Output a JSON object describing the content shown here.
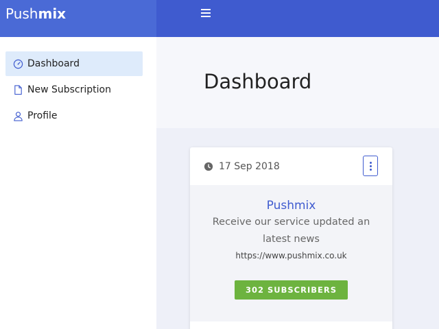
{
  "brand": {
    "part1": "Push",
    "part2": "mix"
  },
  "sidebar": {
    "items": [
      {
        "label": "Dashboard",
        "icon": "speedometer-icon",
        "active": true
      },
      {
        "label": "New Subscription",
        "icon": "document-icon",
        "active": false
      },
      {
        "label": "Profile",
        "icon": "user-icon",
        "active": false
      }
    ]
  },
  "page": {
    "title": "Dashboard"
  },
  "card": {
    "date": "17 Sep 2018",
    "name": "Pushmix",
    "description": "Receive our service updated an latest news",
    "url": "https://www.pushmix.co.uk",
    "subscribers_label": "302 SUBSCRIBERS"
  },
  "colors": {
    "primary": "#3f5bcf",
    "brand_bg": "#4a6ad6",
    "success": "#6db33f",
    "active_nav": "#deebfb"
  }
}
